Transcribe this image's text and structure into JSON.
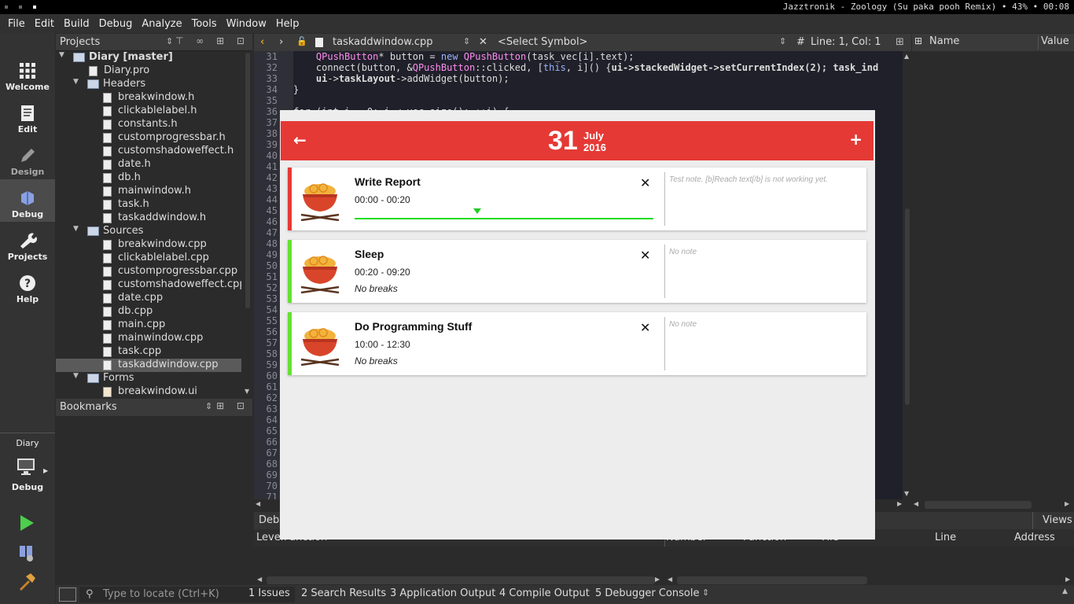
{
  "topbar": {
    "status": "Jazztronik - Zoology (Su paka pooh Remix) • 43% • 00:08"
  },
  "menu": [
    "File",
    "Edit",
    "Build",
    "Debug",
    "Analyze",
    "Tools",
    "Window",
    "Help"
  ],
  "modes": [
    {
      "label": "Welcome",
      "icon": "grid-icon"
    },
    {
      "label": "Edit",
      "icon": "document-icon"
    },
    {
      "label": "Design",
      "icon": "pencil-icon"
    },
    {
      "label": "Debug",
      "icon": "bug-icon"
    },
    {
      "label": "Projects",
      "icon": "wrench-icon"
    },
    {
      "label": "Help",
      "icon": "help-icon"
    }
  ],
  "kit": {
    "project": "Diary",
    "mode": "Debug"
  },
  "projects_panel": {
    "title": "Projects"
  },
  "tree": [
    {
      "label": "Diary [master]",
      "type": "project"
    },
    {
      "label": "Diary.pro",
      "type": "file"
    },
    {
      "label": "Headers",
      "type": "folder"
    },
    {
      "label": "breakwindow.h",
      "type": "file"
    },
    {
      "label": "clickablelabel.h",
      "type": "file"
    },
    {
      "label": "constants.h",
      "type": "file"
    },
    {
      "label": "customprogressbar.h",
      "type": "file"
    },
    {
      "label": "customshadoweffect.h",
      "type": "file"
    },
    {
      "label": "date.h",
      "type": "file"
    },
    {
      "label": "db.h",
      "type": "file"
    },
    {
      "label": "mainwindow.h",
      "type": "file"
    },
    {
      "label": "task.h",
      "type": "file"
    },
    {
      "label": "taskaddwindow.h",
      "type": "file"
    },
    {
      "label": "Sources",
      "type": "folder"
    },
    {
      "label": "breakwindow.cpp",
      "type": "file"
    },
    {
      "label": "clickablelabel.cpp",
      "type": "file"
    },
    {
      "label": "customprogressbar.cpp",
      "type": "file"
    },
    {
      "label": "customshadoweffect.cpp",
      "type": "file"
    },
    {
      "label": "date.cpp",
      "type": "file"
    },
    {
      "label": "db.cpp",
      "type": "file"
    },
    {
      "label": "main.cpp",
      "type": "file"
    },
    {
      "label": "mainwindow.cpp",
      "type": "file"
    },
    {
      "label": "task.cpp",
      "type": "file"
    },
    {
      "label": "taskaddwindow.cpp",
      "type": "file",
      "selected": true
    },
    {
      "label": "Forms",
      "type": "folder"
    },
    {
      "label": "breakwindow.ui",
      "type": "file"
    }
  ],
  "bookmarks": {
    "title": "Bookmarks"
  },
  "editor": {
    "file": "taskaddwindow.cpp",
    "symbol": "<Select Symbol>",
    "hash": "#",
    "position": "Line: 1, Col: 1",
    "line_numbers": [
      "31",
      "32",
      "33",
      "34",
      "35",
      "36",
      "37",
      "38",
      "39",
      "40",
      "41",
      "42",
      "43",
      "44",
      "45",
      "46",
      "47",
      "48",
      "49",
      "50",
      "51",
      "52",
      "53",
      "54",
      "55",
      "56",
      "57",
      "58",
      "59",
      "60",
      "61",
      "62",
      "63",
      "64",
      "65",
      "66",
      "67",
      "68",
      "69",
      "70",
      "71"
    ],
    "code": [
      {
        "a": "    ",
        "b": "QPushButton",
        "c": "* button = ",
        "d": "new ",
        "e": "QPushButton",
        "f": "(task_vec[i].text);"
      },
      {
        "a": "    connect(button, &",
        "b": "QPushButton",
        "c": "::clicked, [",
        "d": "this",
        "e": ", i]() {",
        "f": "ui->stackedWidget->setCurrentIndex(2); task_ind"
      },
      {
        "a": "    ",
        "b": "ui",
        "c": "->",
        "d": "taskLayout",
        "e": "->addWidget(button);",
        "f": ""
      },
      {
        "a": "}",
        "b": "",
        "c": "",
        "d": "",
        "e": "",
        "f": ""
      },
      {
        "a": "",
        "b": "",
        "c": "",
        "d": "",
        "e": "",
        "f": ""
      },
      {
        "a": "for (int i = 0; i < vec.size(); ++i) {",
        "b": "",
        "c": "",
        "d": "",
        "e": "",
        "f": ""
      }
    ]
  },
  "right_panel": {
    "name": "Name",
    "value": "Value"
  },
  "debugger": {
    "tab": "Debu",
    "views": "Views",
    "left_cols": [
      "Level",
      "Function"
    ],
    "right_cols": [
      "Number",
      "Function",
      "File",
      "Line",
      "Address"
    ]
  },
  "output_bar": {
    "locator_placeholder": "Type to locate (Ctrl+K)",
    "tabs": [
      "1  Issues",
      "2  Search Results",
      "3  Application Output",
      "4  Compile Output",
      "5  Debugger Console"
    ]
  },
  "app": {
    "day": "31",
    "month": "July",
    "year": "2016",
    "back_icon": "←",
    "add_icon": "+",
    "tasks": [
      {
        "title": "Write Report",
        "time": "00:00 - 00:20",
        "breaks": "",
        "note": "Test note. [b]Reach text[/b] is not working yet.",
        "accent": "#e53935",
        "progress": 0.41
      },
      {
        "title": "Sleep",
        "time": "00:20 - 09:20",
        "breaks": "No breaks",
        "note": "No note",
        "accent": "#66e033"
      },
      {
        "title": "Do Programming Stuff",
        "time": "10:00 - 12:30",
        "breaks": "No breaks",
        "note": "No note",
        "accent": "#66e033"
      }
    ]
  }
}
